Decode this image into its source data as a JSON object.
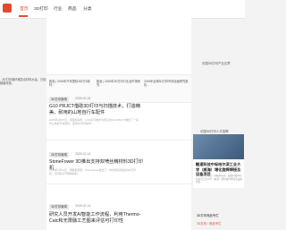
{
  "nav": {
    "items": [
      {
        "label": "首页"
      },
      {
        "label": "3D打印"
      },
      {
        "label": "行业"
      },
      {
        "label": "商品"
      },
      {
        "label": "分类"
      }
    ]
  },
  "left_snippet": "...3D打印碳纤维复合材料大会，已经超越传统。",
  "strip": {
    "items": [
      "新品 | 2026年汽车国际3D打印增材...",
      "新品 | 2026年3D打印行业及市场研究...",
      "2026年全球3D打印市场全面研究报告..."
    ]
  },
  "articles": [
    {
      "tag": "3D打印新闻",
      "date": "2025-02-15",
      "title": "G10 PRJCT借助3D打印与扫描技术，打造精美、耐用的山地自行车配件",
      "desc": "2025年2月15日，南极熊获悉，以3D打印技术为核心的G10 PRJCT推出了一系列山地自行车配件，使用3D打印技术..."
    },
    {
      "tag": "3D打印新闻",
      "date": "2025-02-14",
      "title": "StoneFower 3D推出支持双喷丝精材料3D打印机",
      "desc": "2025年2月14日，南极熊获悉，StoneFower推出了一款支持双喷丝的3D打印机，可同时打印两种材料..."
    },
    {
      "tag": "3D打印新闻",
      "date": "2025-02-14",
      "title": "研究人员开发AI智能工作流程，利用Thermo-Calc和无限融工艺图来评估可打印性",
      "desc": ""
    }
  ],
  "right": {
    "heading": "中国3D打印产业文章",
    "card_heading": "中国3D打印人才招聘",
    "card_title": "融速科技中标哈尔滨工业大学（威海）增化旋焊焊接及设备项目",
    "card_desc": "2025年2月12日，南极熊获悉，融速科技中标哈尔滨工业大学（威海）增化旋焊焊接及设备项目...",
    "bottom_heading": "3D打印商品专栏",
    "bottom_sub": "3D打印 / 商品专栏"
  }
}
